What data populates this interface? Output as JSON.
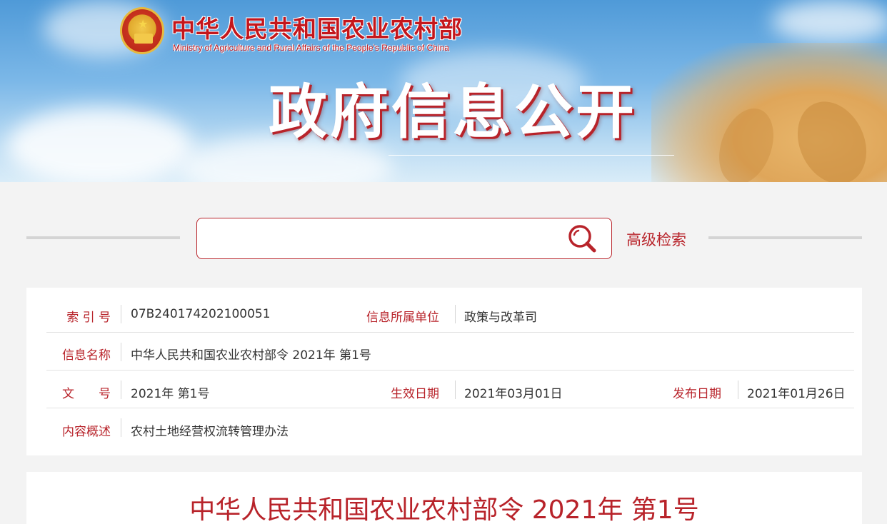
{
  "header": {
    "ministry_name_cn": "中华人民共和国农业农村部",
    "ministry_name_en": "Ministry of Agriculture and Rural Affairs of the People's Republic of China",
    "banner_title": "政府信息公开"
  },
  "search": {
    "placeholder": "",
    "value": "",
    "advanced_label": "高级检索"
  },
  "info": {
    "index_label": "索 引 号",
    "index_value": "07B240174202100051",
    "unit_label": "信息所属单位",
    "unit_value": "政策与改革司",
    "name_label": "信息名称",
    "name_value": "中华人民共和国农业农村部令 2021年 第1号",
    "docno_label": "文　　号",
    "docno_value": "2021年 第1号",
    "effective_label": "生效日期",
    "effective_value": "2021年03月01日",
    "publish_label": "发布日期",
    "publish_value": "2021年01月26日",
    "summary_label": "内容概述",
    "summary_value": "农村土地经营权流转管理办法"
  },
  "document": {
    "title": "中华人民共和国农业农村部令 2021年 第1号"
  },
  "colors": {
    "accent_red": "#b8232a",
    "banner_blue": "#5fa6de",
    "background": "#f3f3f3"
  }
}
